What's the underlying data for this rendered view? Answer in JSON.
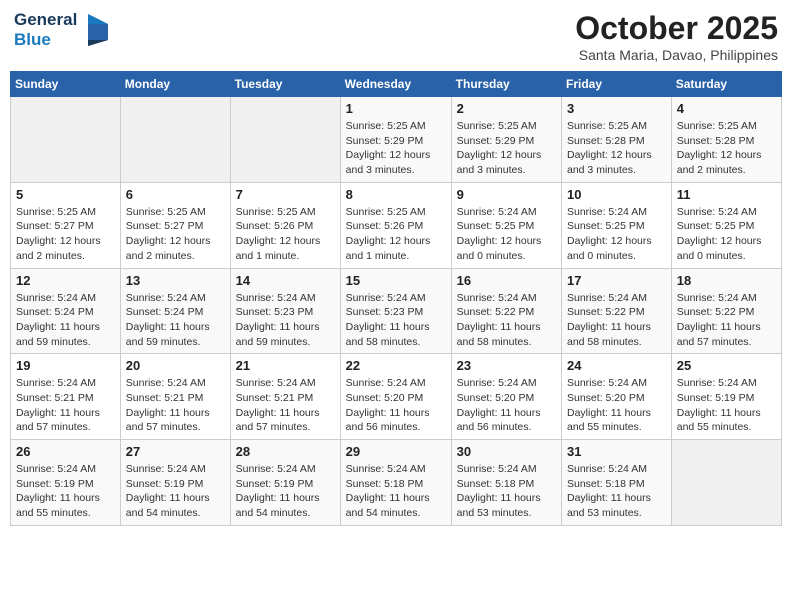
{
  "header": {
    "logo_line1": "General",
    "logo_line2": "Blue",
    "month": "October 2025",
    "location": "Santa Maria, Davao, Philippines"
  },
  "weekdays": [
    "Sunday",
    "Monday",
    "Tuesday",
    "Wednesday",
    "Thursday",
    "Friday",
    "Saturday"
  ],
  "weeks": [
    [
      {
        "day": "",
        "info": ""
      },
      {
        "day": "",
        "info": ""
      },
      {
        "day": "",
        "info": ""
      },
      {
        "day": "1",
        "info": "Sunrise: 5:25 AM\nSunset: 5:29 PM\nDaylight: 12 hours\nand 3 minutes."
      },
      {
        "day": "2",
        "info": "Sunrise: 5:25 AM\nSunset: 5:29 PM\nDaylight: 12 hours\nand 3 minutes."
      },
      {
        "day": "3",
        "info": "Sunrise: 5:25 AM\nSunset: 5:28 PM\nDaylight: 12 hours\nand 3 minutes."
      },
      {
        "day": "4",
        "info": "Sunrise: 5:25 AM\nSunset: 5:28 PM\nDaylight: 12 hours\nand 2 minutes."
      }
    ],
    [
      {
        "day": "5",
        "info": "Sunrise: 5:25 AM\nSunset: 5:27 PM\nDaylight: 12 hours\nand 2 minutes."
      },
      {
        "day": "6",
        "info": "Sunrise: 5:25 AM\nSunset: 5:27 PM\nDaylight: 12 hours\nand 2 minutes."
      },
      {
        "day": "7",
        "info": "Sunrise: 5:25 AM\nSunset: 5:26 PM\nDaylight: 12 hours\nand 1 minute."
      },
      {
        "day": "8",
        "info": "Sunrise: 5:25 AM\nSunset: 5:26 PM\nDaylight: 12 hours\nand 1 minute."
      },
      {
        "day": "9",
        "info": "Sunrise: 5:24 AM\nSunset: 5:25 PM\nDaylight: 12 hours\nand 0 minutes."
      },
      {
        "day": "10",
        "info": "Sunrise: 5:24 AM\nSunset: 5:25 PM\nDaylight: 12 hours\nand 0 minutes."
      },
      {
        "day": "11",
        "info": "Sunrise: 5:24 AM\nSunset: 5:25 PM\nDaylight: 12 hours\nand 0 minutes."
      }
    ],
    [
      {
        "day": "12",
        "info": "Sunrise: 5:24 AM\nSunset: 5:24 PM\nDaylight: 11 hours\nand 59 minutes."
      },
      {
        "day": "13",
        "info": "Sunrise: 5:24 AM\nSunset: 5:24 PM\nDaylight: 11 hours\nand 59 minutes."
      },
      {
        "day": "14",
        "info": "Sunrise: 5:24 AM\nSunset: 5:23 PM\nDaylight: 11 hours\nand 59 minutes."
      },
      {
        "day": "15",
        "info": "Sunrise: 5:24 AM\nSunset: 5:23 PM\nDaylight: 11 hours\nand 58 minutes."
      },
      {
        "day": "16",
        "info": "Sunrise: 5:24 AM\nSunset: 5:22 PM\nDaylight: 11 hours\nand 58 minutes."
      },
      {
        "day": "17",
        "info": "Sunrise: 5:24 AM\nSunset: 5:22 PM\nDaylight: 11 hours\nand 58 minutes."
      },
      {
        "day": "18",
        "info": "Sunrise: 5:24 AM\nSunset: 5:22 PM\nDaylight: 11 hours\nand 57 minutes."
      }
    ],
    [
      {
        "day": "19",
        "info": "Sunrise: 5:24 AM\nSunset: 5:21 PM\nDaylight: 11 hours\nand 57 minutes."
      },
      {
        "day": "20",
        "info": "Sunrise: 5:24 AM\nSunset: 5:21 PM\nDaylight: 11 hours\nand 57 minutes."
      },
      {
        "day": "21",
        "info": "Sunrise: 5:24 AM\nSunset: 5:21 PM\nDaylight: 11 hours\nand 57 minutes."
      },
      {
        "day": "22",
        "info": "Sunrise: 5:24 AM\nSunset: 5:20 PM\nDaylight: 11 hours\nand 56 minutes."
      },
      {
        "day": "23",
        "info": "Sunrise: 5:24 AM\nSunset: 5:20 PM\nDaylight: 11 hours\nand 56 minutes."
      },
      {
        "day": "24",
        "info": "Sunrise: 5:24 AM\nSunset: 5:20 PM\nDaylight: 11 hours\nand 55 minutes."
      },
      {
        "day": "25",
        "info": "Sunrise: 5:24 AM\nSunset: 5:19 PM\nDaylight: 11 hours\nand 55 minutes."
      }
    ],
    [
      {
        "day": "26",
        "info": "Sunrise: 5:24 AM\nSunset: 5:19 PM\nDaylight: 11 hours\nand 55 minutes."
      },
      {
        "day": "27",
        "info": "Sunrise: 5:24 AM\nSunset: 5:19 PM\nDaylight: 11 hours\nand 54 minutes."
      },
      {
        "day": "28",
        "info": "Sunrise: 5:24 AM\nSunset: 5:19 PM\nDaylight: 11 hours\nand 54 minutes."
      },
      {
        "day": "29",
        "info": "Sunrise: 5:24 AM\nSunset: 5:18 PM\nDaylight: 11 hours\nand 54 minutes."
      },
      {
        "day": "30",
        "info": "Sunrise: 5:24 AM\nSunset: 5:18 PM\nDaylight: 11 hours\nand 53 minutes."
      },
      {
        "day": "31",
        "info": "Sunrise: 5:24 AM\nSunset: 5:18 PM\nDaylight: 11 hours\nand 53 minutes."
      },
      {
        "day": "",
        "info": ""
      }
    ]
  ]
}
